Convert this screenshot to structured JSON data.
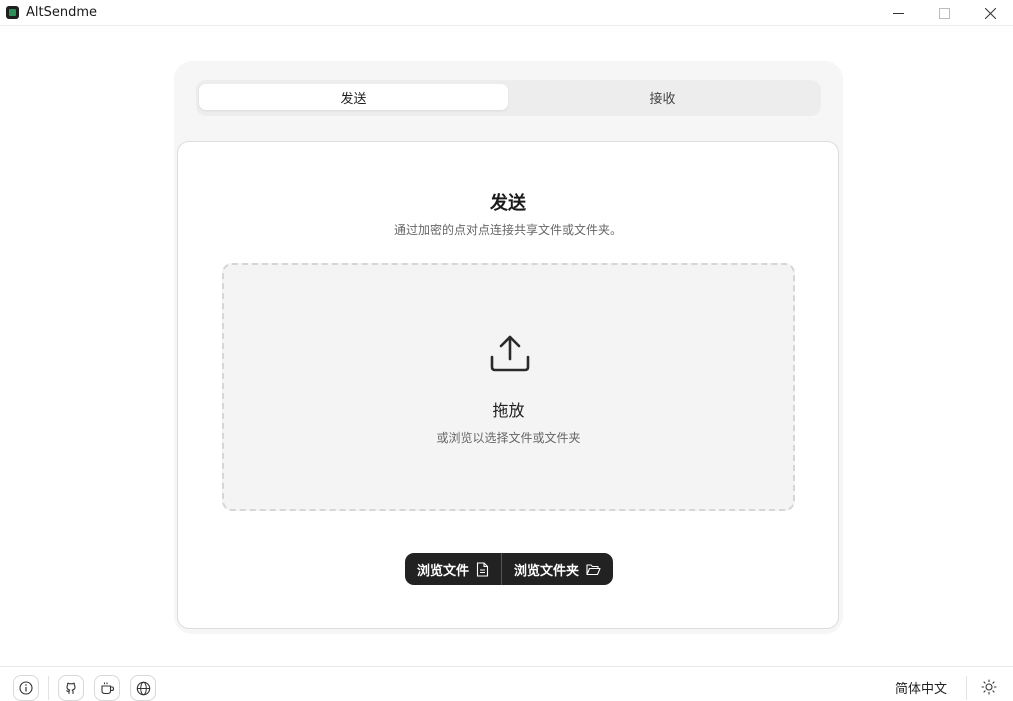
{
  "window": {
    "title": "AltSendme",
    "controls": [
      "minimize-icon",
      "maximize-icon",
      "close-icon"
    ]
  },
  "tabs": [
    {
      "label": "发送",
      "active": true
    },
    {
      "label": "接收",
      "active": false
    }
  ],
  "send_card": {
    "title": "发送",
    "subtitle": "通过加密的点对点连接共享文件或文件夹。",
    "dropzone": {
      "icon": "upload-icon",
      "title": "拖放",
      "subtitle": "或浏览以选择文件或文件夹"
    },
    "buttons": {
      "browse_files": "浏览文件",
      "browse_files_icon": "file-icon",
      "browse_folder": "浏览文件夹",
      "browse_folder_icon": "folder-open-icon"
    }
  },
  "footer": {
    "icons": [
      "info-icon",
      "github-icon",
      "coffee-icon",
      "globe-icon"
    ],
    "language": "简体中文",
    "theme_icon": "sun-icon"
  },
  "colors": {
    "button_bg": "#222222",
    "panel_bg": "#f6f6f6",
    "dropzone_bg": "#f4f4f4",
    "dropzone_border": "#d6d6d6"
  }
}
